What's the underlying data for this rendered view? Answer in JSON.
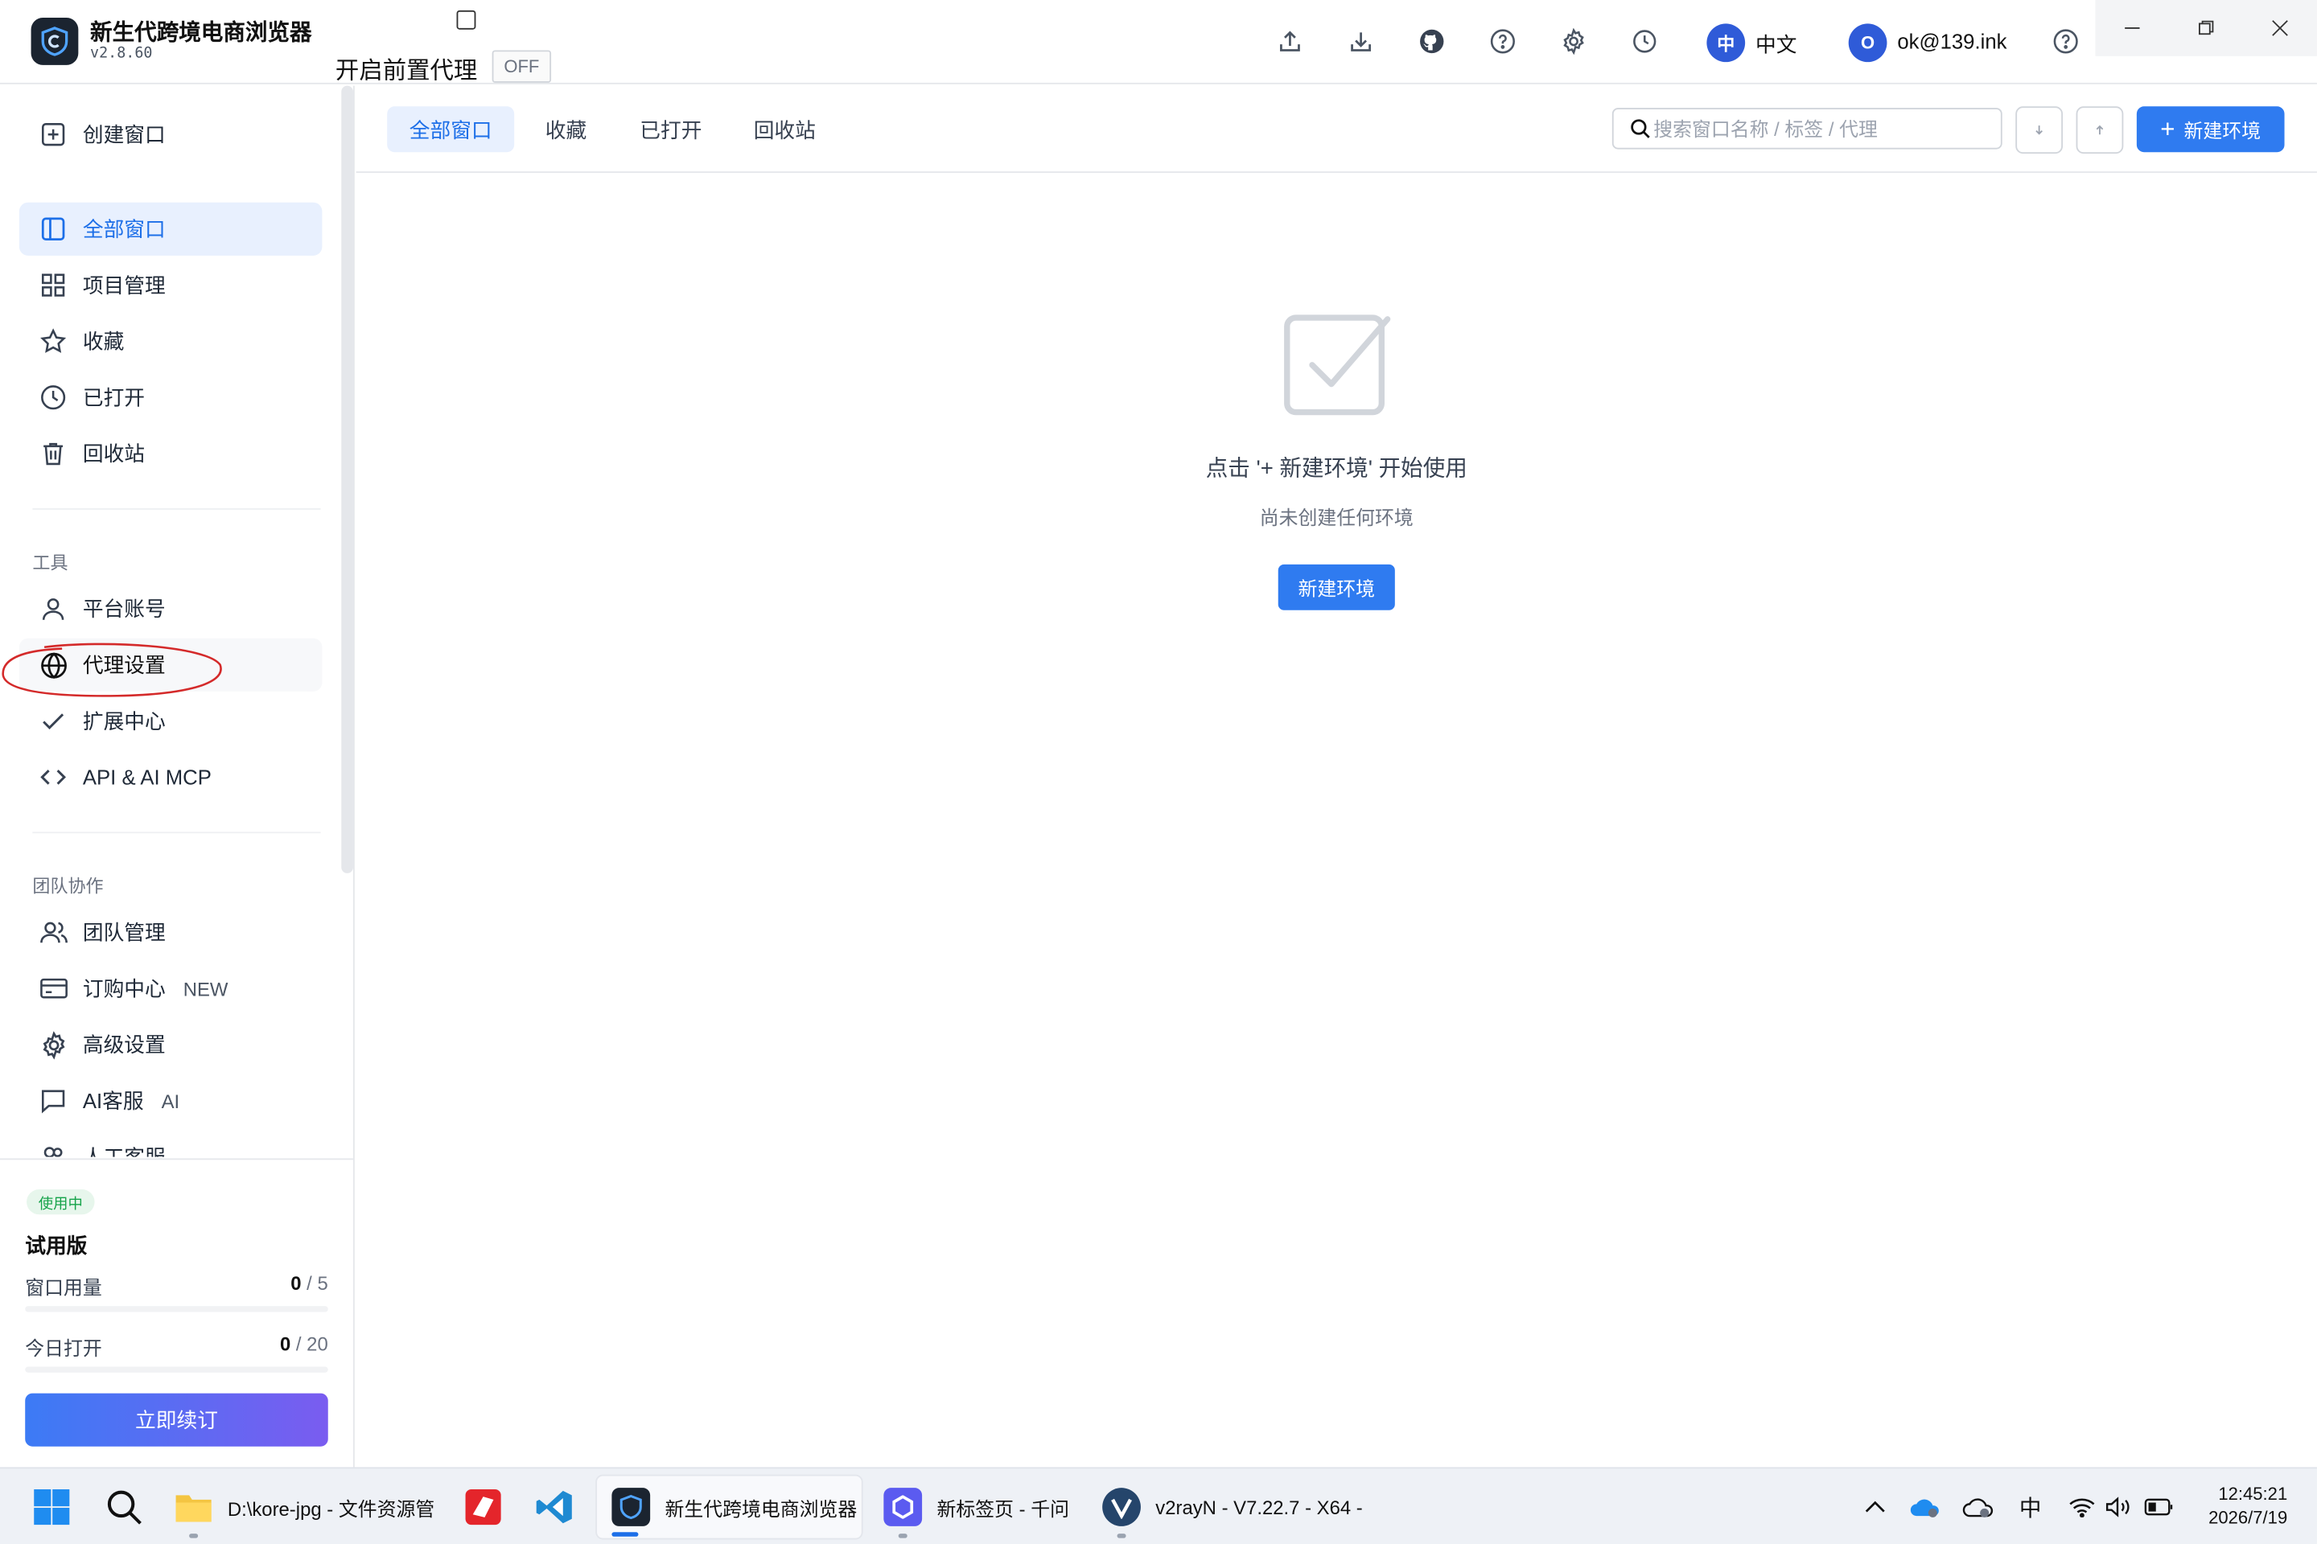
{
  "app": {
    "name": "新生代跨境电商浏览器",
    "version": "v2.8.60",
    "proxy_label": "开启前置代理",
    "proxy_state": "OFF",
    "language": "中文",
    "language_badge": "中",
    "user_email": "ok@139.ink",
    "user_initial": "O"
  },
  "sidebar": {
    "create": "创建窗口",
    "nav": [
      {
        "label": "全部窗口",
        "icon": "panel-icon"
      },
      {
        "label": "项目管理",
        "icon": "grid-icon"
      },
      {
        "label": "收藏",
        "icon": "star-icon"
      },
      {
        "label": "已打开",
        "icon": "clock-icon"
      },
      {
        "label": "回收站",
        "icon": "trash-icon"
      }
    ],
    "tools_title": "工具",
    "tools": [
      {
        "label": "平台账号",
        "icon": "user-icon"
      },
      {
        "label": "代理设置",
        "icon": "globe-icon"
      },
      {
        "label": "扩展中心",
        "icon": "check-icon"
      },
      {
        "label": "API & AI MCP",
        "icon": "code-icon"
      }
    ],
    "team_title": "团队协作",
    "team": [
      {
        "label": "团队管理",
        "icon": "users-icon",
        "badge": ""
      },
      {
        "label": "订购中心",
        "icon": "card-icon",
        "badge": "NEW"
      },
      {
        "label": "高级设置",
        "icon": "gear-icon",
        "badge": ""
      },
      {
        "label": "AI客服",
        "icon": "chat-icon",
        "badge": "AI"
      },
      {
        "label": "人工客服",
        "icon": "headset-icon",
        "badge": ""
      }
    ],
    "plan": {
      "status": "使用中",
      "name": "试用版",
      "window_label": "窗口用量",
      "window_used": "0",
      "window_total": "/ 5",
      "window_fraction": 0,
      "today_label": "今日打开",
      "today_used": "0",
      "today_total": "/ 20",
      "today_fraction": 0,
      "renew": "立即续订"
    }
  },
  "main": {
    "tabs": [
      "全部窗口",
      "收藏",
      "已打开",
      "回收站"
    ],
    "search_placeholder": "搜索窗口名称 / 标签 / 代理",
    "new_env": "新建环境",
    "empty_title": "点击 '+ 新建环境' 开始使用",
    "empty_sub": "尚未创建任何环境",
    "empty_button": "新建环境"
  },
  "taskbar": {
    "apps": [
      {
        "label": "D:\\kore-jpg - 文件资源管",
        "icon": "folder-icon"
      },
      {
        "label": "新生代跨境电商浏览器",
        "icon": "app-browser-icon"
      },
      {
        "label": "新标签页 - 千问",
        "icon": "qianwen-icon"
      },
      {
        "label": "v2rayN - V7.22.7 - X64 -",
        "icon": "v2rayn-icon"
      }
    ],
    "ime": "中",
    "time": "12:45:21",
    "date": "2026/7/19"
  },
  "colors": {
    "accent": "#2f7bf0",
    "active_bg": "#e8f0fe",
    "active_text": "#1d6fe8",
    "annotation": "#d42a2a"
  }
}
